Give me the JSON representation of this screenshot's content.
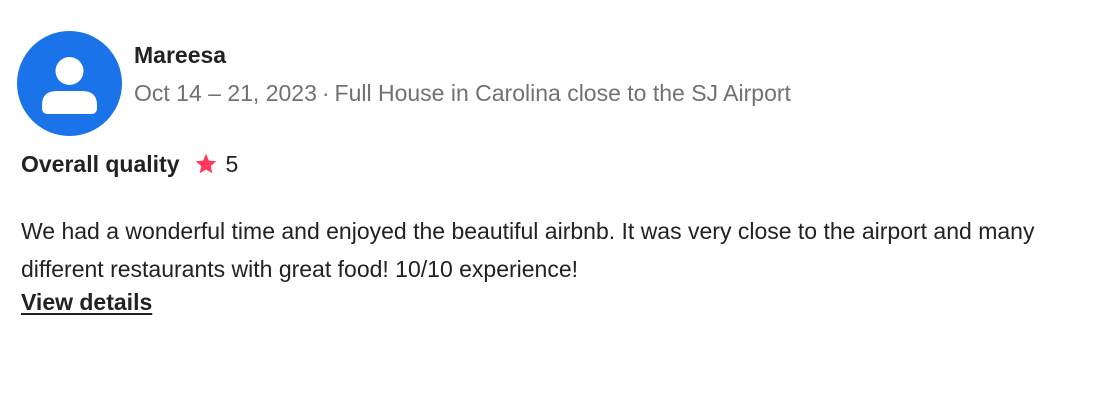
{
  "review": {
    "reviewer_name": "Mareesa",
    "dates": "Oct 14 – 21, 2023",
    "separator": "·",
    "listing_title": "Full House in Carolina close to the SJ Airport",
    "rating_label": "Overall quality",
    "rating_value": "5",
    "text": "We had a wonderful time and enjoyed the beautiful airbnb. It was very close to the airport and many different restaurants with great food! 10/10 experience!",
    "details_link": "View details"
  },
  "icons": {
    "avatar": "person-icon",
    "star": "star-icon"
  },
  "colors": {
    "avatar_background": "#1a73e8",
    "star": "#ff385c",
    "primary_text": "#222222",
    "secondary_text": "#717171"
  }
}
